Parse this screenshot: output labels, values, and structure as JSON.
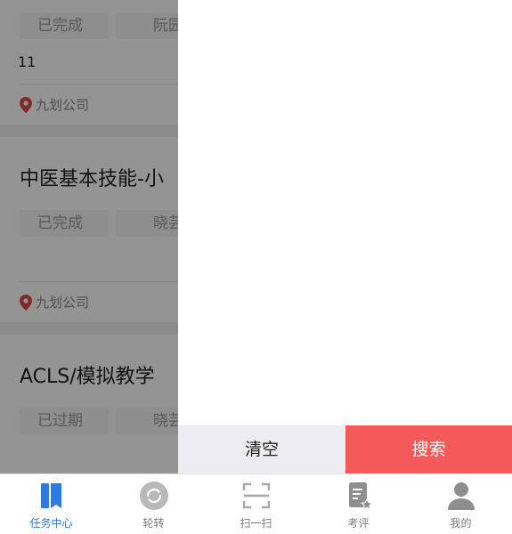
{
  "list": {
    "cards": [
      {
        "status": "已完成",
        "person": "阮园",
        "note": "11",
        "location": "九划公司"
      },
      {
        "title": "中医基本技能-小",
        "status": "已完成",
        "person": "晓芸",
        "location": "九划公司"
      },
      {
        "title": "ACLS/模拟教学",
        "status": "已过期",
        "person": "晓芸"
      }
    ]
  },
  "drawer": {
    "clear_label": "清空",
    "search_label": "搜索"
  },
  "tabbar": {
    "tabs": [
      {
        "label": "任务中心",
        "icon": "book-icon",
        "active": true
      },
      {
        "label": "轮转",
        "icon": "rotation-icon",
        "active": false
      },
      {
        "label": "扫一扫",
        "icon": "scan-icon",
        "active": false
      },
      {
        "label": "考评",
        "icon": "evaluation-icon",
        "active": false
      },
      {
        "label": "我的",
        "icon": "user-icon",
        "active": false
      }
    ]
  },
  "colors": {
    "accent": "#2f7ae0",
    "search_button": "#f45a5a",
    "clear_button": "#ededf1",
    "location_pin": "#d94b4b"
  }
}
